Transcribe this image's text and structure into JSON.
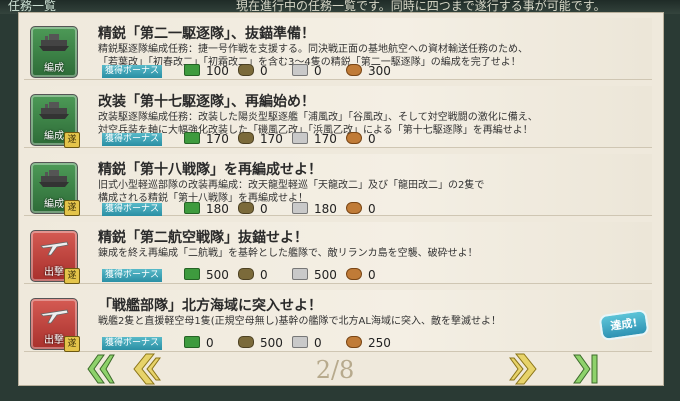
{
  "header": {
    "title": "任務一覧",
    "notice": "現在進行中の任務一覧です。同時に四つまで遂行する事が可能です。"
  },
  "quests": [
    {
      "category": "編成",
      "category_color": "green",
      "title": "精鋭「第二一駆逐隊」、抜錨準備！",
      "desc_lines": [
        "精鋭駆逐隊編成任務：捷一号作戦を支援する。同決戦正面の基地航空への資材輸送任務のため、",
        "「若葉改」「初春改二」「初霜改二」を含む3〜4隻の精鋭「第二一駆逐隊」の編成を完了せよ！"
      ],
      "bonus": "獲得ボーナス",
      "rewards": {
        "fuel": "100",
        "ammo": "0",
        "steel": "0",
        "bauxite": "300"
      }
    },
    {
      "category": "編成",
      "category_color": "green",
      "title": "改装「第十七駆逐隊」、再編始め！",
      "desc_lines": [
        "改装駆逐隊編成任務：改装した陽炎型駆逐艦「浦風改」「谷風改」、そして対空戦闘の激化に備え、",
        "対空兵装を軸に大幅強化改装した「磯風乙改」「浜風乙改」による「第十七駆逐隊」を再編せよ！"
      ],
      "bonus": "獲得ボーナス",
      "rewards": {
        "fuel": "170",
        "ammo": "170",
        "steel": "170",
        "bauxite": "0"
      }
    },
    {
      "category": "編成",
      "category_color": "green",
      "title": "精鋭「第十八戦隊」を再編成せよ！",
      "desc_lines": [
        "旧式小型軽巡部隊の改装再編成：改天龍型軽巡「天龍改二」及び「龍田改二」の2隻で",
        "構成される精鋭「第十八戦隊」を再編成せよ！"
      ],
      "bonus": "獲得ボーナス",
      "rewards": {
        "fuel": "180",
        "ammo": "0",
        "steel": "180",
        "bauxite": "0"
      }
    },
    {
      "category": "出撃",
      "category_color": "red",
      "title": "精鋭「第二航空戦隊」抜錨せよ！",
      "desc_lines": [
        "錬成を終え再編成「二航戦」を基幹とした艦隊で、敵リランカ島を空襲、破砕せよ！"
      ],
      "bonus": "獲得ボーナス",
      "rewards": {
        "fuel": "500",
        "ammo": "0",
        "steel": "500",
        "bauxite": "0"
      }
    },
    {
      "category": "出撃",
      "category_color": "red",
      "title": "「戦艦部隊」北方海域に突入せよ！",
      "desc_lines": [
        "戦艦2隻と直援軽空母1隻(正規空母無し)基幹の艦隊で北方AL海域に突入、敵を撃滅せよ！"
      ],
      "bonus": "獲得ボーナス",
      "rewards": {
        "fuel": "0",
        "ammo": "500",
        "steel": "0",
        "bauxite": "250"
      },
      "status": "達成!"
    }
  ],
  "pagination": {
    "current": "2/8"
  },
  "colors": {
    "green_category": "#3f8a4a",
    "red_category": "#c2413b",
    "bonus_tag": "#3ba2b6",
    "arrow_left": "#e7d36a",
    "arrow_right_green": "#8ed26b"
  }
}
